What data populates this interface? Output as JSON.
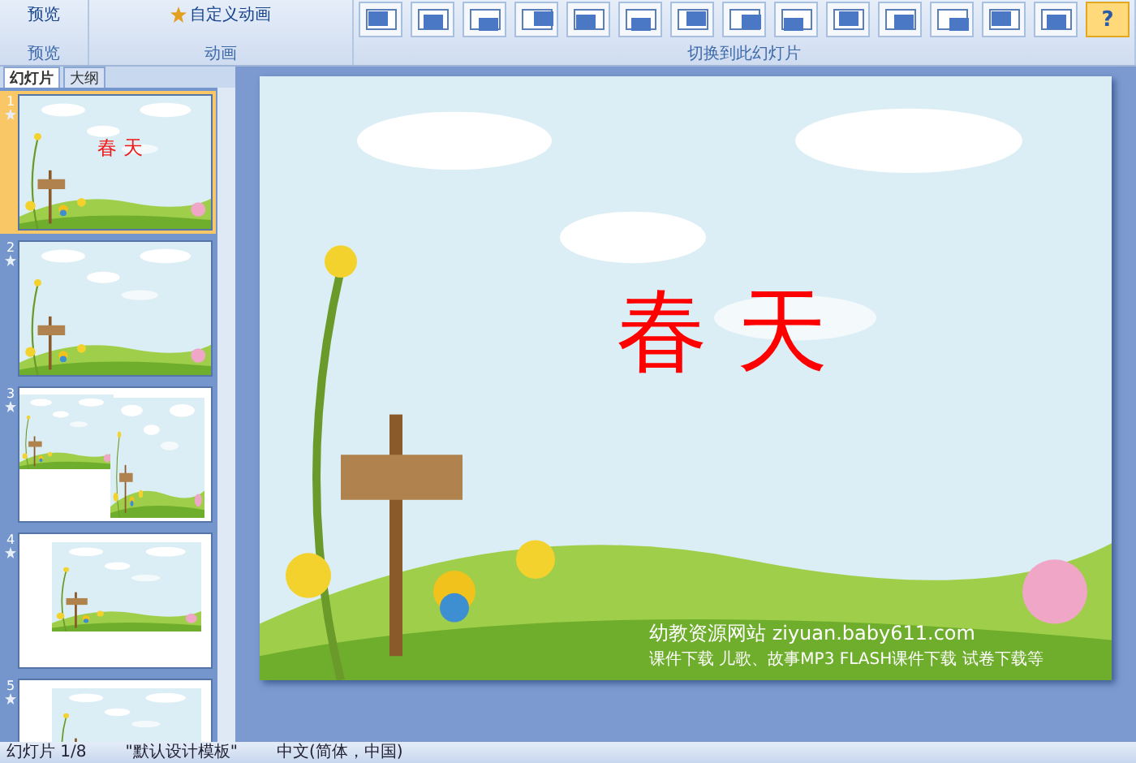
{
  "ribbon": {
    "preview_button": "预览",
    "custom_animation_button": "自定义动画",
    "groups": [
      "预览",
      "动画",
      "切换到此幻灯片"
    ],
    "transitions": [
      {
        "kind": "transition",
        "selected": false
      },
      {
        "kind": "transition",
        "selected": false
      },
      {
        "kind": "transition",
        "selected": false
      },
      {
        "kind": "transition",
        "selected": false
      },
      {
        "kind": "transition",
        "selected": false
      },
      {
        "kind": "transition",
        "selected": false
      },
      {
        "kind": "transition",
        "selected": false
      },
      {
        "kind": "transition",
        "selected": false
      },
      {
        "kind": "transition",
        "selected": false
      },
      {
        "kind": "transition",
        "selected": false
      },
      {
        "kind": "transition",
        "selected": false
      },
      {
        "kind": "transition",
        "selected": false
      },
      {
        "kind": "transition",
        "selected": false
      },
      {
        "kind": "transition",
        "selected": false
      },
      {
        "kind": "help",
        "label": "?",
        "selected": true
      }
    ]
  },
  "panel_tabs": [
    {
      "label": "幻灯片",
      "selected": true
    },
    {
      "label": "大纲",
      "selected": false
    }
  ],
  "slides": [
    {
      "number": "1",
      "selected": true,
      "kind": "title",
      "title": "春 天"
    },
    {
      "number": "2",
      "selected": false,
      "kind": "full"
    },
    {
      "number": "3",
      "selected": false,
      "kind": "split"
    },
    {
      "number": "4",
      "selected": false,
      "kind": "framed"
    },
    {
      "number": "5",
      "selected": false,
      "kind": "framed"
    }
  ],
  "slide": {
    "title": "春 天",
    "site": "幼教资源网站  ziyuan.baby611.com",
    "tagline": "课件下载   儿歌、故事MP3   FLASH课件下载   试卷下载等"
  },
  "status_bar": [
    "幻灯片 1/8",
    "\"默认设计模板\"",
    "中文(简体，中国)"
  ]
}
